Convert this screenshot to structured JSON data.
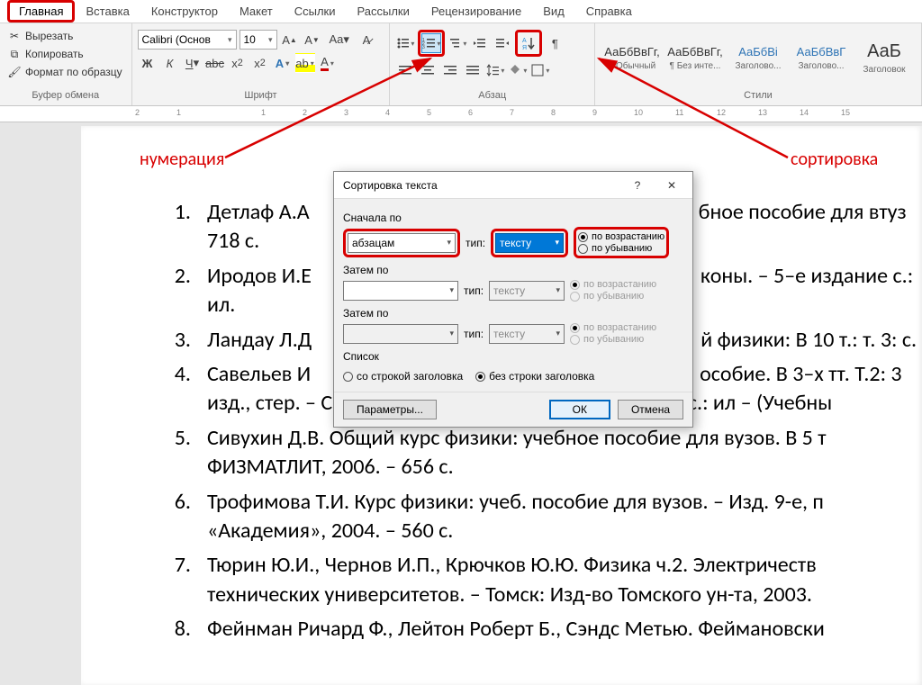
{
  "ribbon": {
    "tabs": [
      "Главная",
      "Вставка",
      "Конструктор",
      "Макет",
      "Ссылки",
      "Рассылки",
      "Рецензирование",
      "Вид",
      "Справка"
    ],
    "active_tab": 0,
    "clipboard": {
      "cut": "Вырезать",
      "copy": "Копировать",
      "format_painter": "Формат по образцу",
      "group_label": "Буфер обмена"
    },
    "font": {
      "font_name": "Calibri (Основ",
      "font_size": "10",
      "group_label": "Шрифт"
    },
    "paragraph": {
      "group_label": "Абзац"
    },
    "styles": {
      "group_label": "Стили",
      "items": [
        {
          "preview": "АаБбВвГг,",
          "name": "¶ Обычный"
        },
        {
          "preview": "АаБбВвГг,",
          "name": "¶ Без инте..."
        },
        {
          "preview": "АаБбВі",
          "name": "Заголово..."
        },
        {
          "preview": "АаБбВвГ",
          "name": "Заголово..."
        },
        {
          "preview": "АаБ",
          "name": "Заголовок"
        }
      ]
    }
  },
  "annotations": {
    "numbering": "нумерация",
    "sorting": "сортировка"
  },
  "document": {
    "items": [
      {
        "num": "1.",
        "text": "Детлаф А.А                  бное пособие для втуз 718 с."
      },
      {
        "num": "2.",
        "text": "Иродов И.Е                  коны. – 5–е издание с.: ил."
      },
      {
        "num": "3.",
        "text": "Ландау Л.Д                  й физики: В 10 т.: т. 3: с."
      },
      {
        "num": "4.",
        "text": "Савельев И                  особие. В 3–х тт. Т.2: 3 изд., стер. – СПб.: Издательство «Лань», 2007. – 496 с.: ил – (Учебны"
      },
      {
        "num": "5.",
        "text": "Сивухин Д.В. Общий курс физики: учебное пособие для вузов. В 5 т ФИЗМАТЛИТ, 2006. – 656 с."
      },
      {
        "num": "6.",
        "text": "Трофимова Т.И. Курс физики: учеб. пособие для вузов. – Изд. 9-е, п «Академия», 2004. – 560 с."
      },
      {
        "num": "7.",
        "text": "Тюрин Ю.И., Чернов И.П., Крючков Ю.Ю. Физика ч.2. Электричеств технических университетов. – Томск: Изд-во Томского ун-та, 2003."
      },
      {
        "num": "8.",
        "text": "Фейнман Ричард Ф., Лейтон Роберт Б., Сэндс Метью. Феймановски"
      }
    ]
  },
  "dialog": {
    "title": "Сортировка текста",
    "first_by": "Сначала по",
    "then_by": "Затем по",
    "list_label": "Список",
    "type_label": "тип:",
    "field1": "абзацам",
    "type1": "тексту",
    "type2": "тексту",
    "type3": "тексту",
    "asc": "по возрастанию",
    "desc": "по убыванию",
    "with_header": "со строкой заголовка",
    "without_header": "без строки заголовка",
    "params": "Параметры...",
    "ok": "ОК",
    "cancel": "Отмена"
  }
}
